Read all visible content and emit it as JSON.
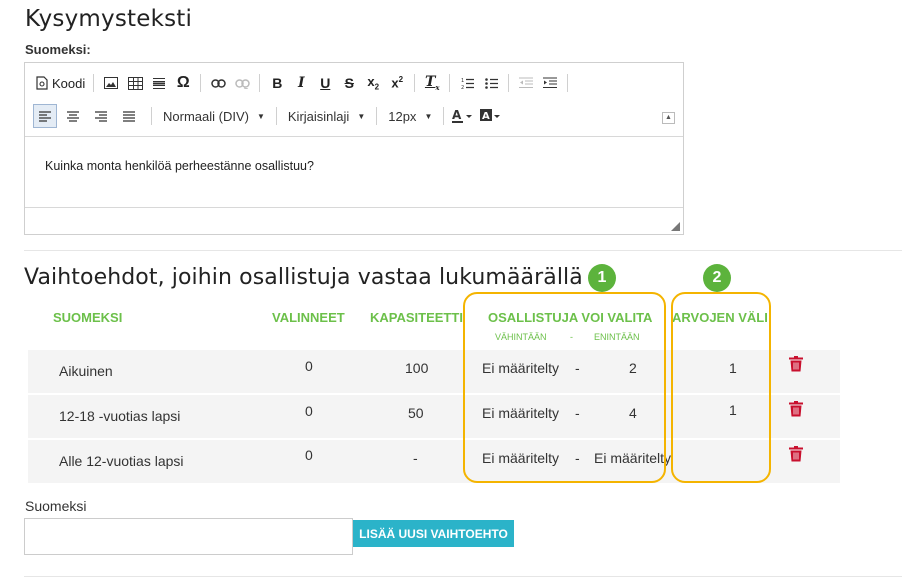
{
  "question": {
    "title": "Kysymysteksti",
    "lang_label": "Suomeksi:"
  },
  "editor": {
    "toolbar_row1": [
      "source-code",
      "image",
      "table",
      "horizontal-rule",
      "special-char",
      "link",
      "unlink",
      "bold",
      "italic",
      "underline",
      "strikethrough",
      "subscript",
      "superscript",
      "remove-format",
      "numbered-list",
      "bulleted-list",
      "outdent",
      "indent"
    ],
    "koodi_label": "Koodi",
    "format_label": "Normaali (DIV)",
    "font_label": "Kirjaisinlaji",
    "size_label": "12px",
    "content": "Kuinka monta henkilöä perheestänne osallistuu?"
  },
  "options": {
    "title": "Vaihtoehdot, joihin osallistuja vastaa lukumäärällä",
    "headers": {
      "name": "SUOMEKSI",
      "selected": "VALINNEET",
      "capacity": "KAPASITEETTI",
      "participant_can_choose": "OSALLISTUJA VOI VALITA",
      "min": "VÄHINTÄÄN",
      "dash": "-",
      "max": "ENINTÄÄN",
      "interval": "ARVOJEN VÄLI"
    },
    "rows": [
      {
        "name": "Aikuinen",
        "selected": "0",
        "capacity": "100",
        "min": "Ei määritelty",
        "dash": "-",
        "max": "2",
        "interval": "1"
      },
      {
        "name": "12-18 -vuotias lapsi",
        "selected": "0",
        "capacity": "50",
        "min": "Ei määritelty",
        "dash": "-",
        "max": "4",
        "interval": "1"
      },
      {
        "name": "Alle 12-vuotias lapsi",
        "selected": "0",
        "capacity": "-",
        "min": "Ei määritelty",
        "dash": "-",
        "max": "Ei määritelty",
        "interval": ""
      }
    ],
    "badges": [
      "1",
      "2"
    ]
  },
  "new_option": {
    "label": "Suomeksi",
    "value": "",
    "button": "LISÄÄ UUSI VAIHTOEHTO"
  },
  "colors": {
    "accent_green": "#6cc04a",
    "badge_green": "#5cb33c",
    "highlight": "#f4b400",
    "button_teal": "#2bb3c9",
    "trash_red": "#c8102e"
  }
}
